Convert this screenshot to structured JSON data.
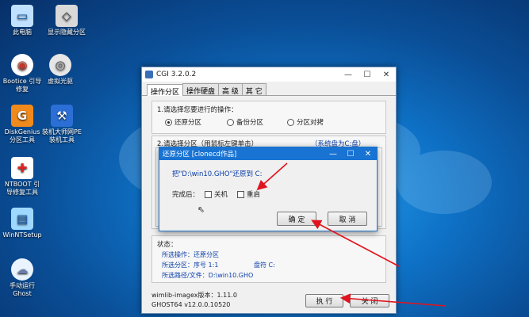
{
  "desktop": {
    "icons": [
      {
        "label": "此电脑",
        "icon": "computer-icon"
      },
      {
        "label": "显示隐藏分区",
        "icon": "partition-icon"
      },
      {
        "label": "Bootice 引导\n修复",
        "icon": "bootice-icon"
      },
      {
        "label": "虚拟光驱",
        "icon": "cdrom-icon"
      },
      {
        "label": "DiskGenius\n分区工具",
        "icon": "diskgenius-icon"
      },
      {
        "label": "装机大师网PE\n装机工具",
        "icon": "installer-icon"
      },
      {
        "label": "NTBOOT 引\n导修复工具",
        "icon": "ntboot-icon"
      },
      {
        "label": "WinNTSetup",
        "icon": "winntsetup-icon"
      },
      {
        "label": "手动运行\nGhost",
        "icon": "ghost-icon"
      }
    ]
  },
  "window": {
    "title": "CGI 3.2.0.2",
    "tabs": [
      "操作分区",
      "操作硬盘",
      "高 级",
      "其 它"
    ],
    "step1_label": "1.请选择您要进行的操作：",
    "options": [
      "还原分区",
      "备份分区",
      "分区对拷"
    ],
    "step2_label": "2.请选择分区（用鼠标左键单击）",
    "step2_hint": "（系统盘为C:盘）",
    "status_label": "状态：",
    "status": {
      "operation": "所选操作：还原分区",
      "partition": "所选分区：序号 1:1",
      "drive": "盘符 C:",
      "path": "所选路径/文件：D:\\win10.GHO"
    },
    "footer_line1": "wimlib-imagex版本：1.11.0",
    "footer_line2": "GHOST64 v12.0.0.10520",
    "execute_label": "执 行",
    "close_label": "关 闭"
  },
  "dialog": {
    "title": "还原分区 [clonecd作品]",
    "message": "把\"D:\\win10.GHO\"还原到 C:",
    "after_label": "完成后：",
    "checkboxes": [
      "关机",
      "重启"
    ],
    "confirm_label": "确 定",
    "cancel_label": "取 消"
  },
  "colors": {
    "accent": "#1873d3",
    "status_text": "#0a3ea8",
    "annotation_arrow": "#e0141e"
  }
}
